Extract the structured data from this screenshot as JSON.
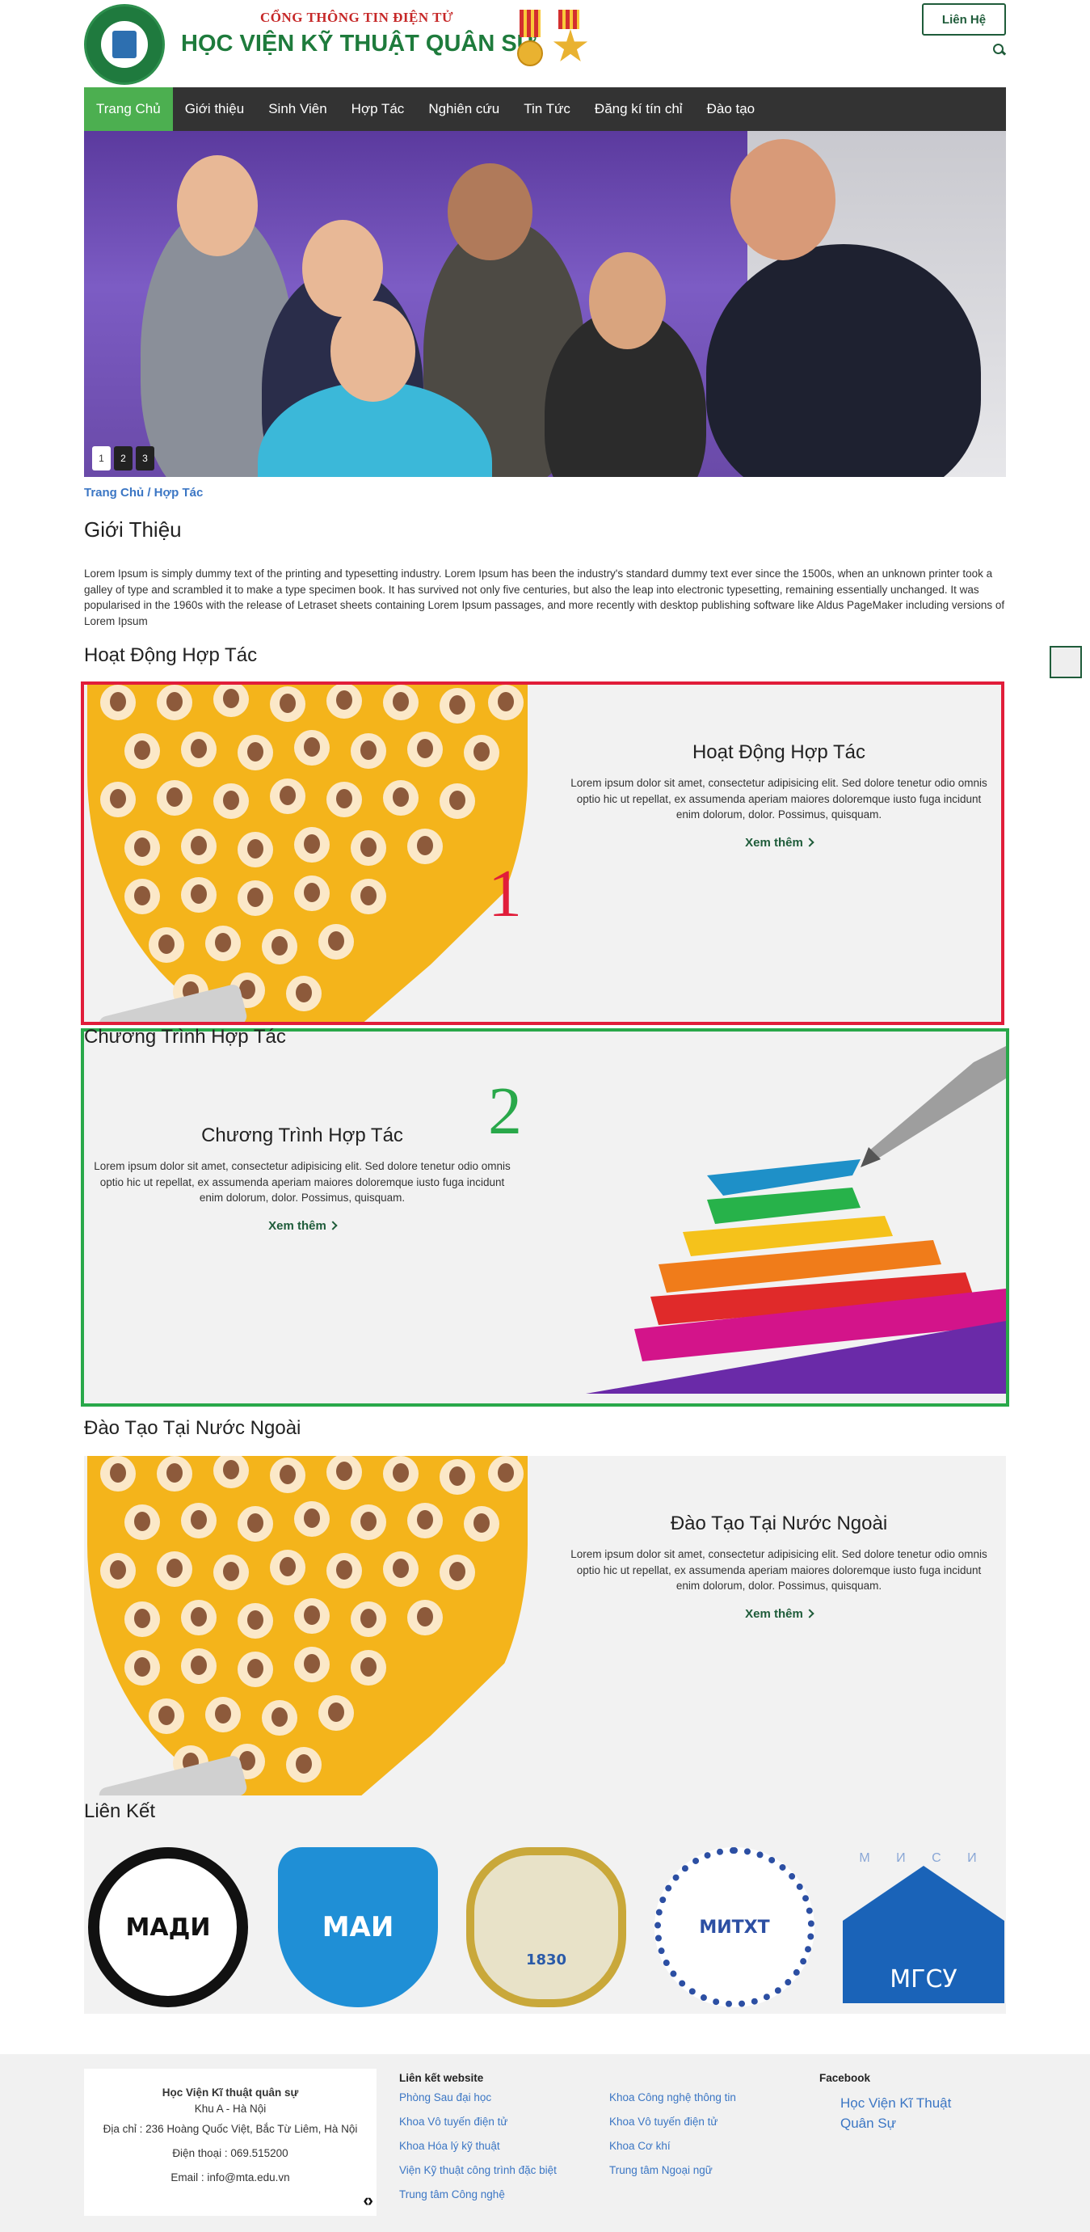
{
  "header": {
    "subtitle": "CỔNG THÔNG TIN ĐIỆN TỬ",
    "title": "HỌC VIỆN KỸ THUẬT QUÂN SỰ",
    "contact_label": "Liên Hệ"
  },
  "nav": {
    "items": [
      "Trang Chủ",
      "Giới thiệu",
      "Sinh Viên",
      "Hợp Tác",
      "Nghiên cứu",
      "Tin Tức",
      "Đăng kí tín chỉ",
      "Đào tạo"
    ]
  },
  "hero": {
    "slides": [
      "1",
      "2",
      "3"
    ],
    "active_slide": 1
  },
  "breadcrumb": "Trang Chủ / Hợp Tác",
  "intro": {
    "heading": "Giới Thiệu",
    "text": "Lorem Ipsum is simply dummy text of the printing and typesetting industry. Lorem Ipsum has been the industry's standard dummy text ever since the 1500s, when an unknown printer took a galley of type and scrambled it to make a type specimen book. It has survived not only five centuries, but also the leap into electronic typesetting, remaining essentially unchanged. It was popularised in the 1960s with the release of Letraset sheets containing Lorem Ipsum passages, and more recently with desktop publishing software like Aldus PageMaker including versions of Lorem Ipsum"
  },
  "sections": [
    {
      "heading": "Hoạt Động Hợp Tác",
      "title": "Hoạt Động Hợp Tác",
      "body": "Lorem ipsum dolor sit amet, consectetur adipisicing elit. Sed dolore tenetur odio omnis optio hic ut repellat, ex assumenda aperiam maiores doloremque iusto fuga incidunt enim dolorum, dolor. Possimus, quisquam.",
      "link": "Xem thêm",
      "annotation": "1"
    },
    {
      "heading": "Chương Trình Hợp Tác",
      "title": "Chương Trình Hợp Tác",
      "body": "Lorem ipsum dolor sit amet, consectetur adipisicing elit. Sed dolore tenetur odio omnis optio hic ut repellat, ex assumenda aperiam maiores doloremque iusto fuga incidunt enim dolorum, dolor. Possimus, quisquam.",
      "link": "Xem thêm",
      "annotation": "2"
    },
    {
      "heading": "Đào Tạo Tại Nước Ngoài",
      "title": "Đào Tạo Tại Nước Ngoài",
      "body": "Lorem ipsum dolor sit amet, consectetur adipisicing elit. Sed dolore tenetur odio omnis optio hic ut repellat, ex assumenda aperiam maiores doloremque iusto fuga incidunt enim dolorum, dolor. Possimus, quisquam.",
      "link": "Xem thêm"
    }
  ],
  "partners": {
    "heading": "Liên Kết",
    "logos": [
      {
        "text": "МАДИ",
        "color": "#111111"
      },
      {
        "text": "МАИ",
        "color": "#1f8fd6"
      },
      {
        "text": "1830",
        "color": "#2a5aa8"
      },
      {
        "text": "МИТХТ",
        "color": "#2c4fa3"
      },
      {
        "text": "МГСУ",
        "color": "#1a63b8",
        "top_text": "М И С И"
      }
    ]
  },
  "footer": {
    "org": {
      "name": "Học Viện Kĩ thuật quân sự",
      "area": "Khu A - Hà Nội",
      "address": "Địa chỉ : 236 Hoàng Quốc Việt, Bắc Từ Liêm, Hà Nội",
      "phone": "Điện thoại : 069.515200",
      "email": "Email : info@mta.edu.vn"
    },
    "links_title": "Liên kết website",
    "links_col1": [
      "Phòng Sau đại học",
      "Khoa Vô tuyến điện tử",
      "Khoa Hóa lý kỹ thuật",
      "Viện Kỹ thuật công trình đặc biệt",
      "Trung tâm Công nghệ"
    ],
    "links_col2": [
      "Khoa Công nghệ thông tin",
      "Khoa Vô tuyến điện tử",
      "Khoa Cơ khí",
      "Trung tâm Ngoại ngữ"
    ],
    "facebook_title": "Facebook",
    "facebook_link": "Học Viện Kĩ Thuật Quân Sự"
  },
  "colors": {
    "nav_bg": "#333333",
    "nav_active": "#4caf50",
    "brand_green": "#1e7b3c",
    "link_blue": "#3b76c4",
    "annotation_red": "#e11d3a",
    "annotation_green": "#29a84a"
  }
}
